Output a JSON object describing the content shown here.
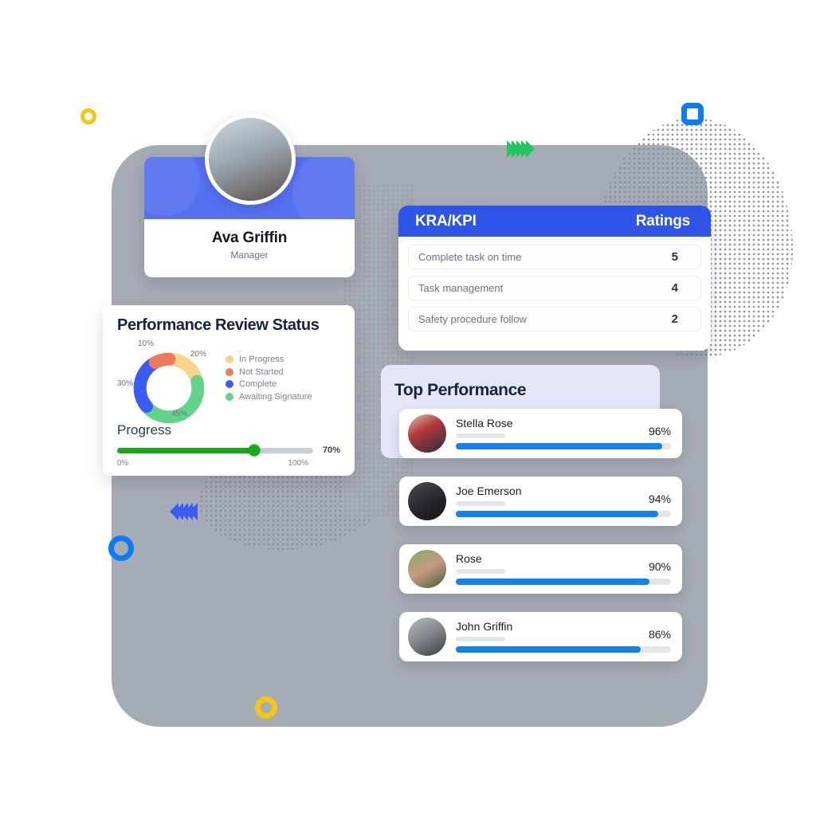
{
  "profile": {
    "name": "Ava Griffin",
    "role": "Manager",
    "avatar_icon": "user-photo-avatar"
  },
  "review": {
    "title": "Performance Review Status",
    "progress_label": "Progress",
    "progress_value": 70,
    "progress_value_label": "70%",
    "scale_min": "0%",
    "scale_max": "100%",
    "donut_labels": {
      "top_left": "10%",
      "top_right": "20%",
      "left": "30%",
      "bottom": "45%"
    },
    "legend": [
      {
        "label": "In Progress",
        "color": "#f8d48a"
      },
      {
        "label": "Not Started",
        "color": "#ef7a5a"
      },
      {
        "label": "Complete",
        "color": "#3b5bf5"
      },
      {
        "label": "Awaiting Signature",
        "color": "#62d48a"
      }
    ]
  },
  "chart_data": {
    "type": "pie",
    "title": "Performance Review Status",
    "categories": [
      "In Progress",
      "Not Started",
      "Complete",
      "Awaiting Signature"
    ],
    "values": [
      20,
      10,
      30,
      45
    ],
    "labels": [
      "20%",
      "10%",
      "30%",
      "45%"
    ],
    "colors": [
      "#f8d48a",
      "#ef7a5a",
      "#3b5bf5",
      "#62d48a"
    ],
    "donut": true,
    "legend_position": "right",
    "grid": false
  },
  "kra": {
    "header_left": "KRA/KPI",
    "header_right": "Ratings",
    "header_color": "#2f55e8",
    "rows": [
      {
        "name": "Complete task on time",
        "rating": "5"
      },
      {
        "name": "Task management",
        "rating": "4"
      },
      {
        "name": "Safety procedure follow",
        "rating": "2"
      }
    ]
  },
  "top_performance": {
    "title": "Top Performance",
    "panel_color": "#e4e7fa",
    "bar_color": "#1282ef",
    "rows": [
      {
        "name": "Stella Rose",
        "pct_label": "96%",
        "pct": 96,
        "avatar_icon": "user-photo-avatar"
      },
      {
        "name": "Joe Emerson",
        "pct_label": "94%",
        "pct": 94,
        "avatar_icon": "user-photo-avatar"
      },
      {
        "name": "Rose",
        "pct_label": "90%",
        "pct": 90,
        "avatar_icon": "user-photo-avatar"
      },
      {
        "name": "John Griffin",
        "pct_label": "86%",
        "pct": 86,
        "avatar_icon": "user-photo-avatar"
      }
    ]
  },
  "decorations": {
    "ring_yellow_top_left": "ring-icon",
    "ring_blue_top_right": "ring-icon",
    "ring_blue_bottom_left": "ring-icon",
    "ring_yellow_bottom": "ring-icon",
    "chevrons_green": "chevron-right-icon",
    "chevrons_blue": "chevron-left-icon"
  }
}
